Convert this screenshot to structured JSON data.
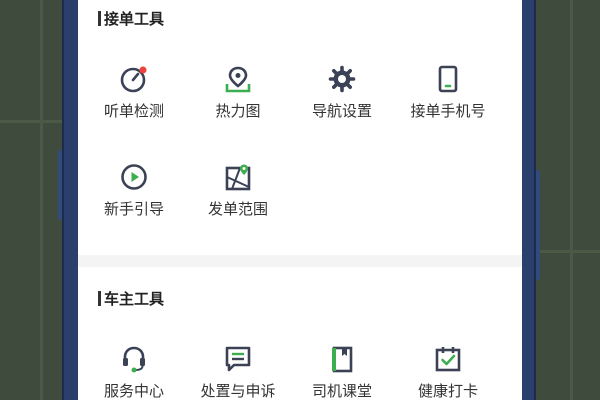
{
  "sections": [
    {
      "title": "接单工具",
      "items": [
        {
          "label": "听单检测",
          "icon": "gauge-icon"
        },
        {
          "label": "热力图",
          "icon": "location-pin-icon"
        },
        {
          "label": "导航设置",
          "icon": "gear-icon"
        },
        {
          "label": "接单手机号",
          "icon": "phone-icon"
        },
        {
          "label": "新手引导",
          "icon": "play-circle-icon"
        },
        {
          "label": "发单范围",
          "icon": "map-range-icon"
        }
      ]
    },
    {
      "title": "车主工具",
      "items": [
        {
          "label": "服务中心",
          "icon": "headset-icon"
        },
        {
          "label": "处置与申诉",
          "icon": "message-icon"
        },
        {
          "label": "司机课堂",
          "icon": "book-icon"
        },
        {
          "label": "健康打卡",
          "icon": "calendar-check-icon"
        }
      ]
    }
  ],
  "colors": {
    "icon_dark": "#3b4256",
    "accent_green": "#3dae4f",
    "notification_red": "#f0423c"
  }
}
